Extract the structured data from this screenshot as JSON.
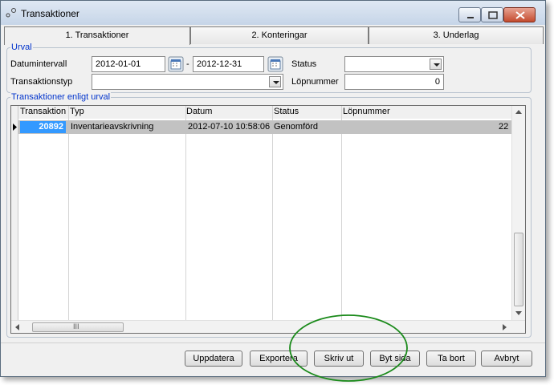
{
  "window": {
    "title": "Transaktioner"
  },
  "tabs": [
    {
      "label": "1. Transaktioner",
      "active": true
    },
    {
      "label": "2. Konteringar",
      "active": false
    },
    {
      "label": "3. Underlag",
      "active": false
    }
  ],
  "urval": {
    "legend": "Urval",
    "datumintervall_label": "Datumintervall",
    "date_from": "2012-01-01",
    "date_separator": "-",
    "date_to": "2012-12-31",
    "status_label": "Status",
    "status_value": "",
    "transaktionstyp_label": "Transaktionstyp",
    "transaktionstyp_value": "",
    "lopnummer_label": "Löpnummer",
    "lopnummer_value": "0"
  },
  "results": {
    "legend": "Transaktioner enligt urval",
    "columns": [
      "Transaktion",
      "Typ",
      "Datum",
      "Status",
      "Löpnummer"
    ],
    "rows": [
      {
        "transaktion": "20892",
        "typ": "Inventarieavskrivning",
        "datum": "2012-07-10 10:58:06",
        "status": "Genomförd",
        "lopnummer": "22"
      }
    ],
    "hscroll_grip": "III"
  },
  "buttons": {
    "uppdatera": "Uppdatera",
    "exportera": "Exportera",
    "skriv_ut": "Skriv ut",
    "byt_sida": "Byt sida",
    "ta_bort": "Ta bort",
    "avbryt": "Avbryt"
  },
  "colors": {
    "selection": "#3399ff",
    "selected_row": "#c2c2c2",
    "group_legend": "#0033cc",
    "annotation_ellipse": "#1a8a1a"
  }
}
